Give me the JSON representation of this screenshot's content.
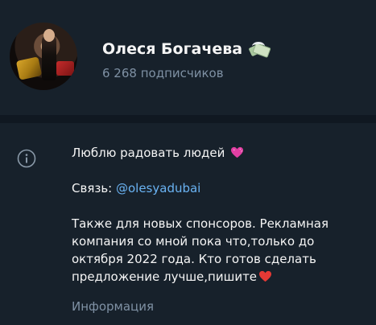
{
  "channel": {
    "name": "Олеся Богачева",
    "name_icon": "money-with-wings-icon",
    "subscribers": "6 268 подписчиков"
  },
  "info": {
    "icon": "info-circle-icon",
    "line1": "Люблю радовать людей",
    "line1_emoji": "sparkling-heart-icon",
    "contact_label": "Связь: ",
    "contact_link": "@olesyadubai",
    "description_line1": "Также для новых спонсоров. Рекламная",
    "description_line2": "компания со мной пока что,только до",
    "description_line3": "октября 2022 года. Кто готов сделать",
    "description_line4": "предложение лучше,пишите",
    "description_emoji": "red-heart-icon",
    "label": "Информация"
  },
  "colors": {
    "background": "#17212b",
    "divider": "#101821",
    "primary_text": "#f5f5f5",
    "secondary_text": "#7f91a4",
    "link": "#6ab3f3"
  }
}
